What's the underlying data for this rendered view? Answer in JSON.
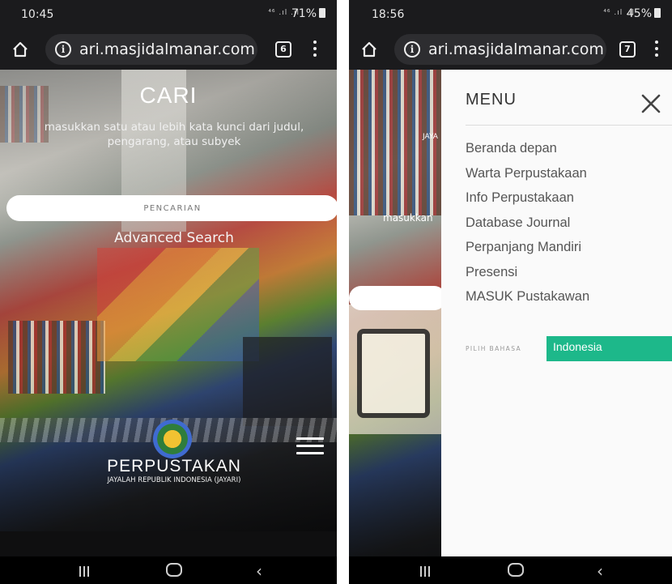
{
  "left_screen": {
    "status": {
      "time": "10:45",
      "signal": "⁴⁶ .ıl .ıl",
      "battery": "71%"
    },
    "browser": {
      "url": "ari.masjidalmanar.com",
      "tab_count": "6"
    },
    "page": {
      "title": "CARI",
      "subtitle": "masukkan satu atau lebih kata kunci dari judul, pengarang, atau subyek",
      "search_placeholder": "PENCARIAN",
      "advanced_search": "Advanced Search",
      "brand_name": "PERPUSTAKAN",
      "brand_sub": "JAYALAH REPUBLIK INDONESIA (JAYARI)"
    }
  },
  "right_screen": {
    "status": {
      "time": "18:56",
      "signal": "⁴⁶ .ıl .ıl",
      "battery": "45%"
    },
    "browser": {
      "url": "ari.masjidalmanar.com",
      "tab_count": "7"
    },
    "background_fragments": {
      "jaya": "JAYA",
      "masukkan": "masukkan"
    },
    "menu": {
      "title": "MENU",
      "items": [
        "Beranda depan",
        "Warta Perpustakaan",
        "Info Perpustakaan",
        "Database Journal",
        "Perpanjang Mandiri",
        "Presensi",
        "MASUK Pustakawan"
      ],
      "language_label": "PILIH BAHASA",
      "language_value": "Indonesia",
      "language_color": "#1db88a"
    }
  },
  "icons": [
    "home-icon",
    "info-icon",
    "tabs-icon",
    "kebab-menu-icon",
    "hamburger-icon",
    "close-icon",
    "nav-recent-icon",
    "nav-home-icon",
    "nav-back-icon",
    "library-logo"
  ]
}
